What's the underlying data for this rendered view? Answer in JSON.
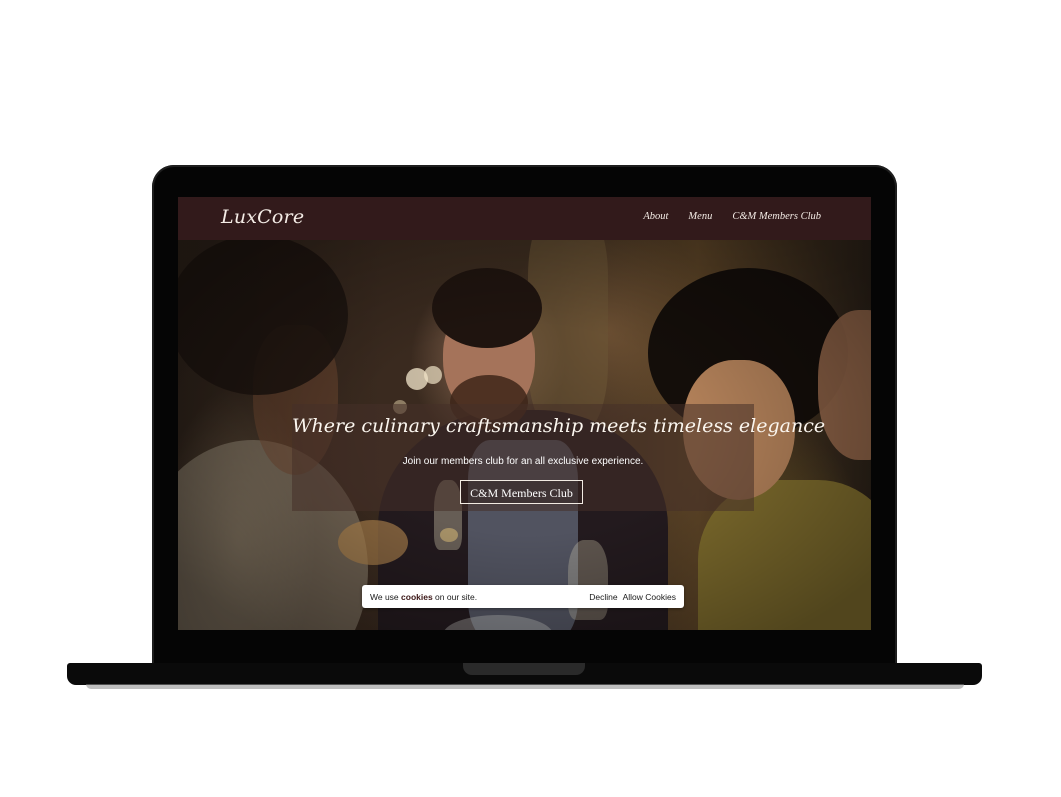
{
  "site": {
    "brand": "LuxCore"
  },
  "nav": {
    "items": [
      {
        "label": "About"
      },
      {
        "label": "Menu"
      },
      {
        "label": "C&M Members Club"
      }
    ]
  },
  "hero": {
    "title": "Where culinary craftsmanship meets timeless elegance",
    "subtitle": "Join our members club for an all exclusive experience.",
    "cta_label": "C&M Members Club"
  },
  "cookie_banner": {
    "text_prefix": "We use ",
    "text_highlight": "cookies",
    "text_suffix": " on our site.",
    "decline_label": "Decline",
    "allow_label": "Allow Cookies"
  },
  "colors": {
    "navbar": "#321a1b",
    "text_light": "#f4ece6",
    "laptop_frame": "#050505"
  }
}
